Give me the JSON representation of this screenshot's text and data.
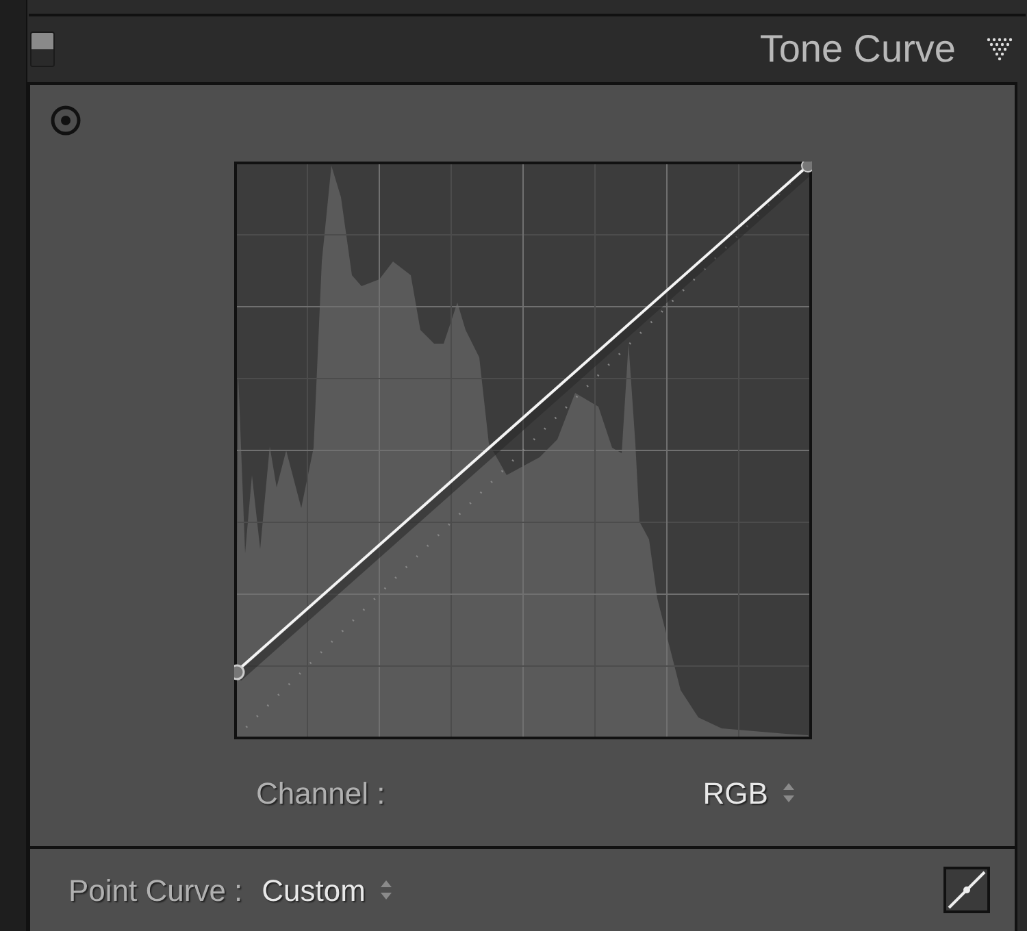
{
  "panel": {
    "title": "Tone Curve",
    "enabled": true,
    "expanded": true
  },
  "channel": {
    "label": "Channel :",
    "value": "RGB"
  },
  "point_curve": {
    "label": "Point Curve :",
    "value": "Custom"
  }
}
